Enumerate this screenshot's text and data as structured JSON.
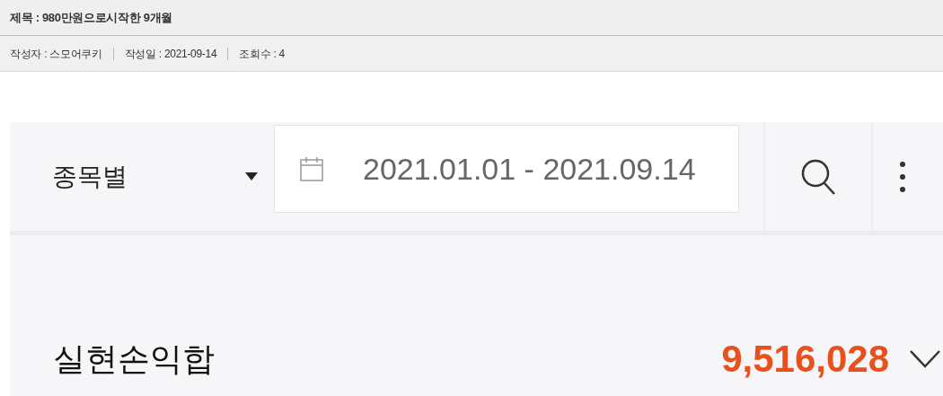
{
  "post": {
    "title": "제목 : 980만원으로시작한 9개월",
    "meta": [
      {
        "text": "작성자 : 스모어쿠키"
      },
      {
        "text": "작성일 : 2021-09-14"
      },
      {
        "text": "조회수 : 4"
      }
    ]
  },
  "app": {
    "filter": {
      "label": "종목별"
    },
    "date_range": {
      "value": "2021.01.01 - 2021.09.14"
    },
    "summary": {
      "label": "실현손익합",
      "value": "9,516,028",
      "expanded": false
    }
  }
}
